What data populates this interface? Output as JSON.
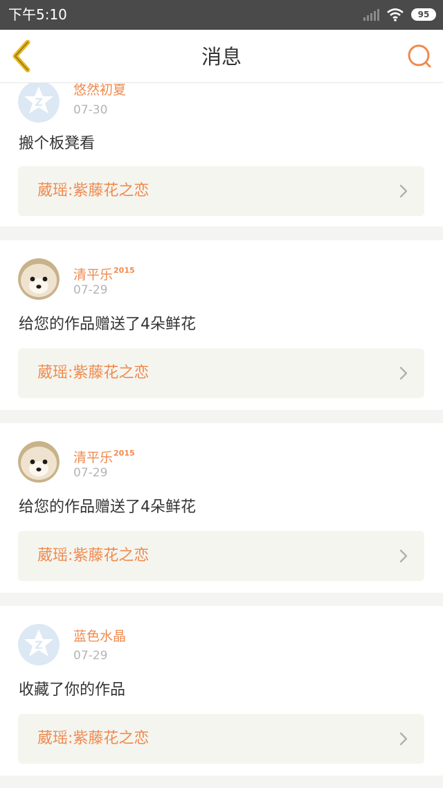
{
  "status_bar": {
    "time": "下午5:10",
    "battery": "95"
  },
  "header": {
    "title": "消息",
    "back_icon": "back-arrow-icon",
    "search_icon": "search-icon"
  },
  "colors": {
    "accent": "#ef8a4e",
    "back_icon": "#e8b820",
    "link_bg": "#f5f5ef"
  },
  "messages": [
    {
      "user": "悠然初夏",
      "user_suffix": "",
      "date": "07-30",
      "text": "搬个板凳看",
      "work": "葳瑶:紫藤花之恋",
      "avatar": "default-avatar-icon"
    },
    {
      "user": "清平乐",
      "user_suffix": "2015",
      "date": "07-29",
      "text": "给您的作品赠送了4朵鲜花",
      "work": "葳瑶:紫藤花之恋",
      "avatar": "dog-avatar"
    },
    {
      "user": "清平乐",
      "user_suffix": "2015",
      "date": "07-29",
      "text": "给您的作品赠送了4朵鲜花",
      "work": "葳瑶:紫藤花之恋",
      "avatar": "dog-avatar"
    },
    {
      "user": "蓝色水晶",
      "user_suffix": "",
      "date": "07-29",
      "text": "收藏了你的作品",
      "work": "葳瑶:紫藤花之恋",
      "avatar": "default-avatar-icon"
    }
  ]
}
